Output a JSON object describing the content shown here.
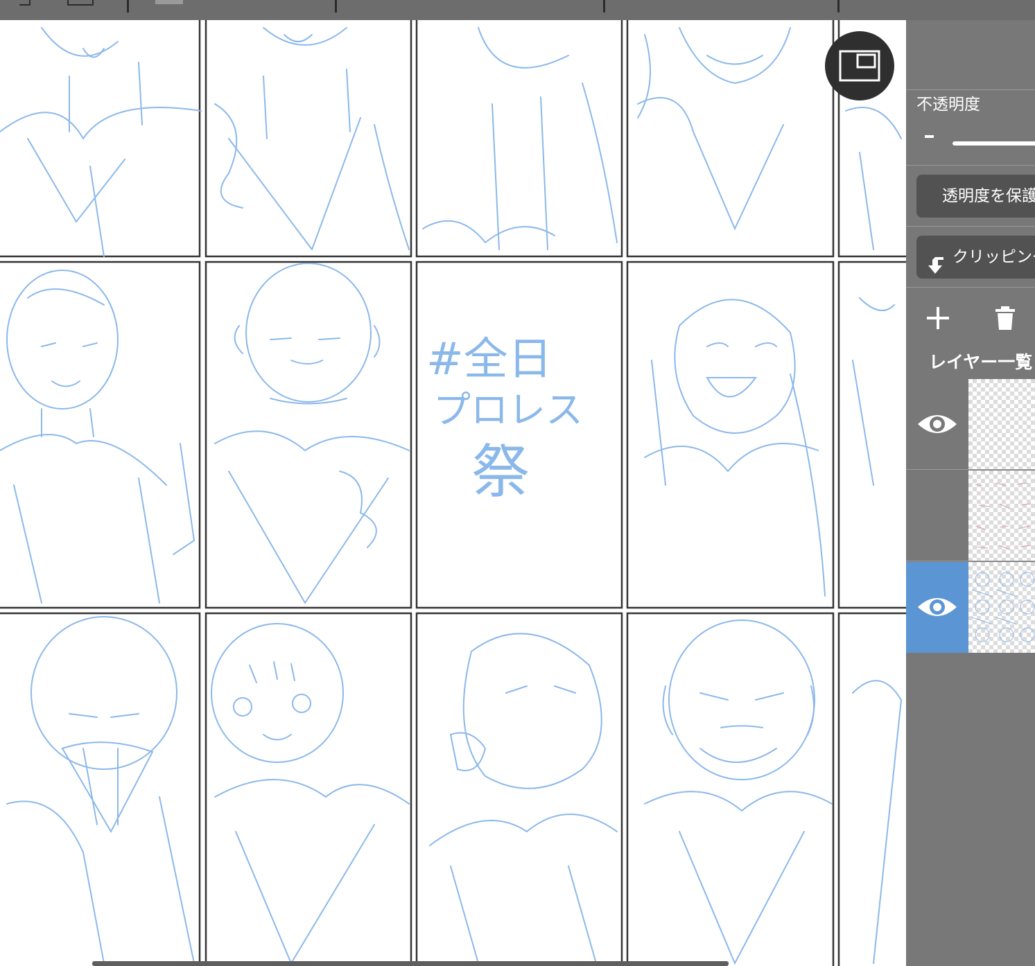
{
  "toolbar": {
    "icons": [
      "redo-icon",
      "canvas-icon",
      "layer-icon"
    ]
  },
  "canvas": {
    "panel_note_lines": [
      "#全日",
      "プロレス",
      "祭"
    ],
    "stroke_color": "#8bb8ea",
    "frame_color": "#333333"
  },
  "view_toggle": {
    "icon": "window-layout-icon"
  },
  "layer_panel": {
    "opacity_label": "不透明度",
    "opacity_minus": "-",
    "protect_alpha_label": "透明度を保護",
    "clipping_label": "クリッピング",
    "list_title": "レイヤー一覧",
    "selected_color": "#5b95d3",
    "layers": [
      {
        "visible": true,
        "selected": false,
        "thumb": "transparent"
      },
      {
        "visible": false,
        "selected": false,
        "thumb": "red-sketch"
      },
      {
        "visible": true,
        "selected": true,
        "thumb": "blue-sketch"
      }
    ]
  }
}
